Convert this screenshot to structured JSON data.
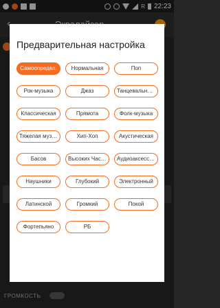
{
  "status_bar": {
    "time": "22:23",
    "network_label": "R"
  },
  "background": {
    "title": "Эквалайзер",
    "volume_label": "ГРОМКОСТЬ"
  },
  "dialog": {
    "title": "Предварительная настройка",
    "presets": [
      {
        "label": "Самоопредел.",
        "selected": true
      },
      {
        "label": "Нормальная",
        "selected": false
      },
      {
        "label": "Поп",
        "selected": false
      },
      {
        "label": "Рок-музыка",
        "selected": false
      },
      {
        "label": "Джаз",
        "selected": false
      },
      {
        "label": "Танцевальная...",
        "selected": false
      },
      {
        "label": "Классическая",
        "selected": false
      },
      {
        "label": "Прямота",
        "selected": false
      },
      {
        "label": "Фолк-музыка",
        "selected": false
      },
      {
        "label": "Тяжелая музы...",
        "selected": false
      },
      {
        "label": "Хип-Хоп",
        "selected": false
      },
      {
        "label": "Акустическая",
        "selected": false
      },
      {
        "label": "Басов",
        "selected": false
      },
      {
        "label": "Высоких Част...",
        "selected": false
      },
      {
        "label": "Аудиоаксессу...",
        "selected": false
      },
      {
        "label": "Наушники",
        "selected": false
      },
      {
        "label": "Глубокий",
        "selected": false
      },
      {
        "label": "Электронный",
        "selected": false
      },
      {
        "label": "Латинской",
        "selected": false
      },
      {
        "label": "Громкий",
        "selected": false
      },
      {
        "label": "Покой",
        "selected": false
      },
      {
        "label": "Фортепьяно",
        "selected": false
      },
      {
        "label": "РБ",
        "selected": false
      }
    ]
  },
  "colors": {
    "accent": "#f36c21"
  }
}
